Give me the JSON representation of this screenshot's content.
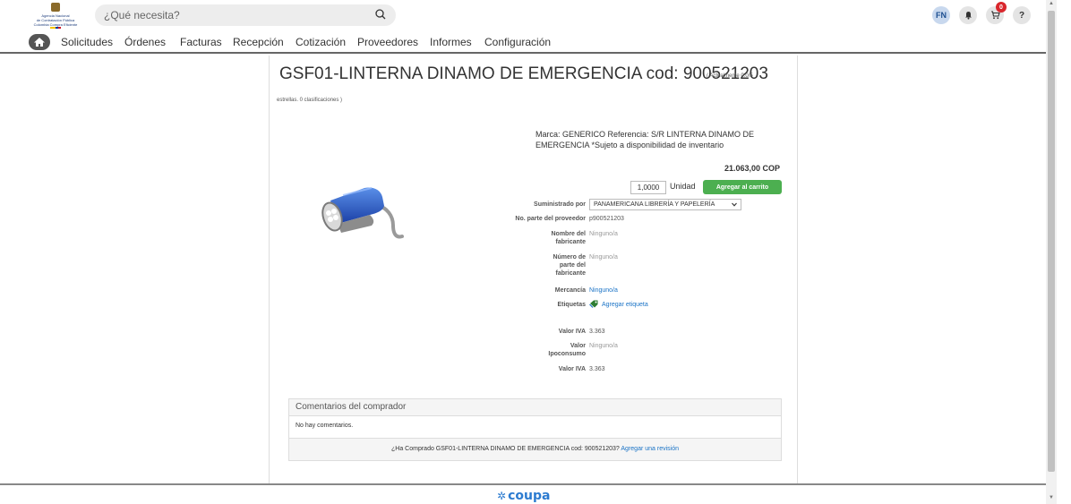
{
  "header": {
    "logo": {
      "line1": "Agencia Nacional",
      "line2": "de Contratación Pública",
      "line3": "Colombia Compra Eficiente"
    },
    "search": {
      "placeholder": "¿Qué necesita?",
      "icon": "search-icon"
    },
    "user_initials": "FN",
    "notifications_icon": "bell-icon",
    "cart_icon": "cart-icon",
    "cart_count": "0",
    "help_label": "?"
  },
  "nav": {
    "home_icon": "home-icon",
    "items": [
      "Solicitudes",
      "Órdenes",
      "Facturas",
      "Recepción",
      "Cotización",
      "Proveedores",
      "Informes",
      "Configuración"
    ]
  },
  "product": {
    "title": "GSF01-LINTERNA DINAMO DE EMERGENCIA cod: 900521203",
    "rating_part1": "( Actualmente 0.0/5",
    "rating_part2": "estrellas. 0 clasificaciones )",
    "description": "Marca: GENERICO Referencia: S/R LINTERNA DINAMO DE EMERGENCIA *Sujeto a disponibilidad de inventario",
    "price": "21.063,00 COP",
    "quantity": "1,0000",
    "unit": "Unidad",
    "add_to_cart": "Agregar al carrito",
    "supplied_by_label": "Suministrado por",
    "supplier": "PANAMERICANA LIBRERÍA Y PAPELERÍA",
    "supplier_part_label": "No. parte del proveedor",
    "supplier_part": "p900521203",
    "manufacturer_name_label": "Nombre del fabricante",
    "manufacturer_name": "Ninguno/a",
    "manufacturer_part_label": "Número de parte del fabricante",
    "manufacturer_part": "Ninguno/a",
    "commodity_label": "Mercancía",
    "commodity": "Ninguno/a",
    "tags_label": "Etiquetas",
    "add_tag": "Agregar etiqueta",
    "iva_label": "Valor IVA",
    "iva_value": "3.363",
    "ipoconsumo_label": "Valor Ipoconsumo",
    "ipoconsumo_value": "Ninguno/a",
    "iva2_label": "Valor IVA",
    "iva2_value": "3.363"
  },
  "comments": {
    "header": "Comentarios del comprador",
    "empty": "No hay comentarios.",
    "prompt": "¿Ha Comprado GSF01-LINTERNA DINAMO DE EMERGENCIA cod: 900521203?",
    "review_link": "Agregar una revisión"
  },
  "footer": {
    "brand": "coupa"
  }
}
